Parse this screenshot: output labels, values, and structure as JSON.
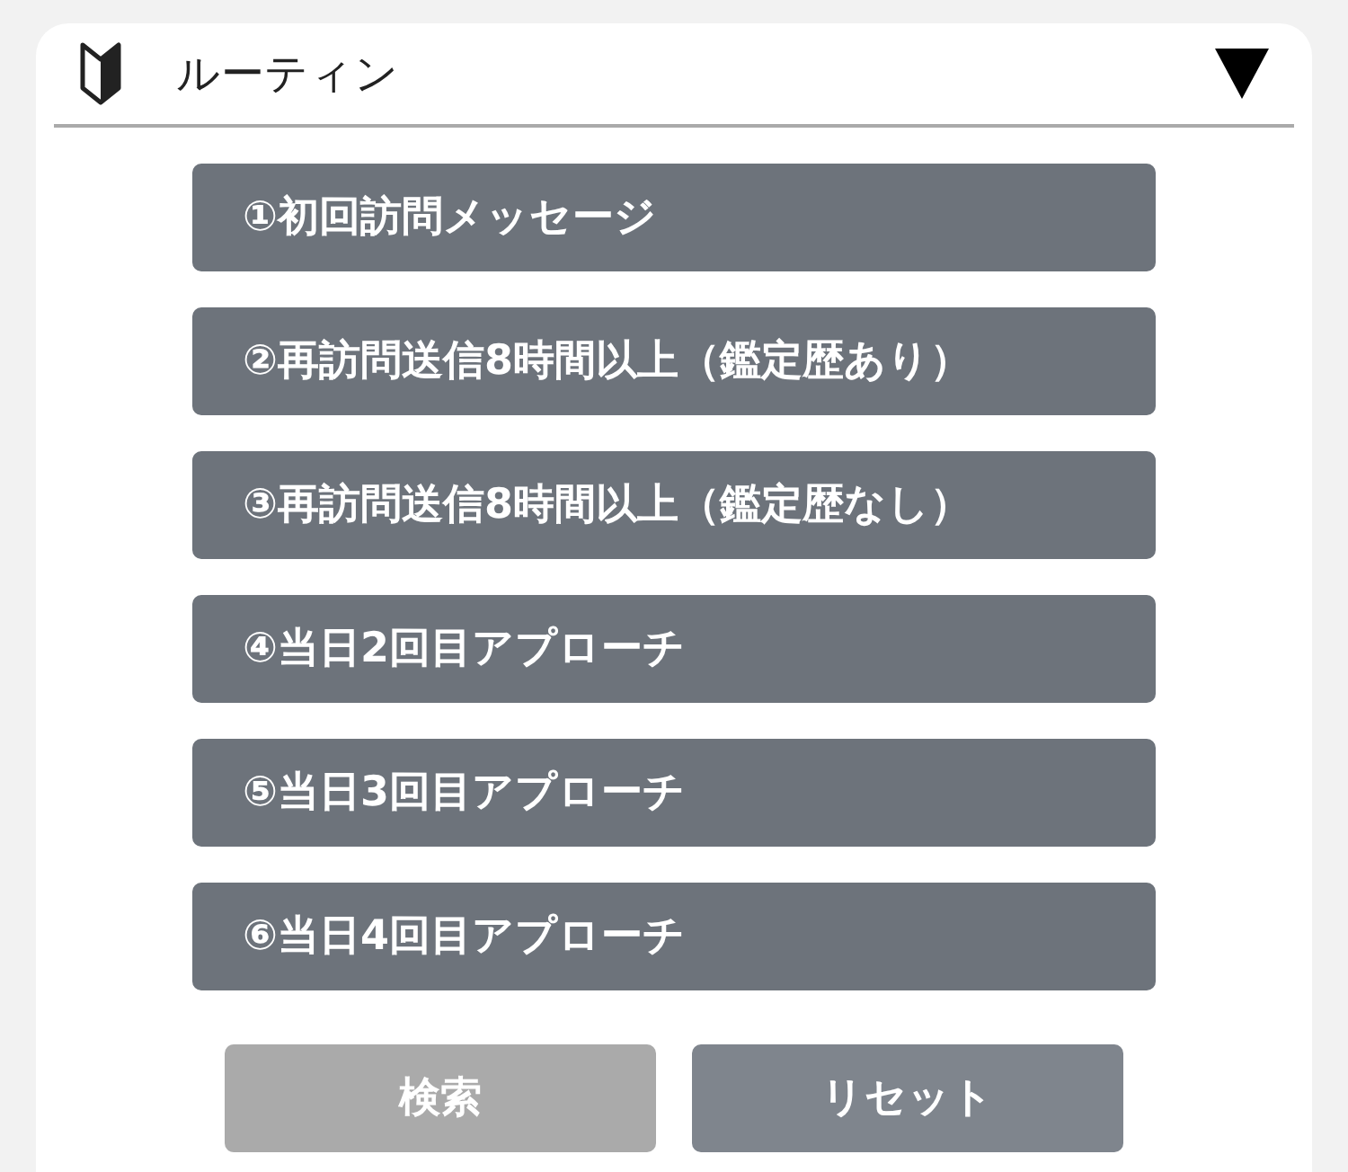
{
  "panel": {
    "title": "ルーティン",
    "expanded": true
  },
  "routines": [
    "①初回訪問メッセージ",
    "②再訪問送信8時間以上（鑑定歴あり）",
    "③再訪問送信8時間以上（鑑定歴なし）",
    "④当日2回目アプローチ",
    "⑤当日3回目アプローチ",
    "⑥当日4回目アプローチ"
  ],
  "actions": [
    {
      "label": "検索",
      "disabled": true
    },
    {
      "label": "リセット",
      "disabled": false
    }
  ]
}
